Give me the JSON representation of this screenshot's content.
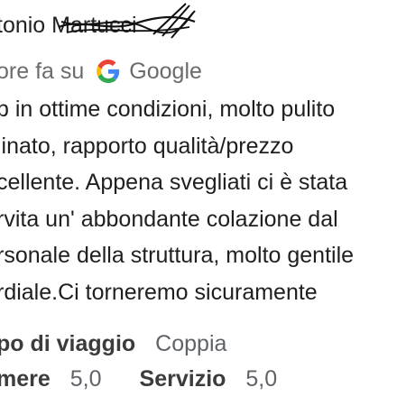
{
  "review": {
    "author_name": "tonio Martucci",
    "time_ago": "ore fa su",
    "source": "Google",
    "source_icon": "google-g-icon",
    "lines": [
      "b in ottime condizioni, molto pulito",
      "linato, rapporto qualità/prezzo",
      "cellente. Appena svegliati ci è stata",
      "rvita un' abbondante colazione dal",
      "rsonale della struttura, molto gentile",
      "rdiale.Ci torneremo sicuramente"
    ]
  },
  "details": {
    "trip_type_label": "po di viaggio",
    "trip_type_value": "Coppia",
    "rooms_label": "mere",
    "rooms_value": "5,0",
    "service_label": "Servizio",
    "service_value": "5,0"
  },
  "colors": {
    "google_blue": "#4285F4",
    "google_red": "#EA4335",
    "google_yellow": "#FBBC05",
    "google_green": "#34A853"
  }
}
